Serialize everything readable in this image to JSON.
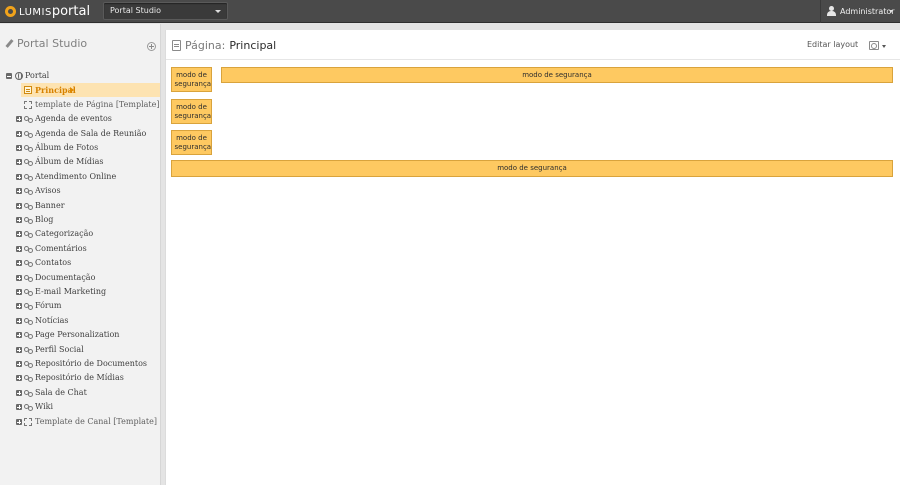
{
  "topbar": {
    "logo_prefix": "LUMIS",
    "logo_suffix": "portal",
    "portal_select_value": "Portal Studio",
    "user_name": "Administrator",
    "colors": {
      "bar": "#4a4a4a",
      "logo_accent": "#f1a31b"
    }
  },
  "sidebar": {
    "title": "Portal Studio",
    "tree": [
      {
        "label": "Portal",
        "icon": "globe-icon",
        "toggle": "collapse"
      },
      {
        "label": "Principal",
        "icon": "page-icon",
        "selected": true
      },
      {
        "label": "template de Página [Template]",
        "icon": "template-icon"
      },
      {
        "label": "Agenda de eventos",
        "icon": "channel-icon",
        "toggle": "expand"
      },
      {
        "label": "Agenda de Sala de Reunião",
        "icon": "channel-icon",
        "toggle": "expand"
      },
      {
        "label": "Álbum de Fotos",
        "icon": "channel-icon",
        "toggle": "expand"
      },
      {
        "label": "Álbum de Mídias",
        "icon": "channel-icon",
        "toggle": "expand"
      },
      {
        "label": "Atendimento Online",
        "icon": "channel-icon",
        "toggle": "expand"
      },
      {
        "label": "Avisos",
        "icon": "channel-icon",
        "toggle": "expand"
      },
      {
        "label": "Banner",
        "icon": "channel-icon",
        "toggle": "expand"
      },
      {
        "label": "Blog",
        "icon": "channel-icon",
        "toggle": "expand"
      },
      {
        "label": "Categorização",
        "icon": "channel-icon",
        "toggle": "expand"
      },
      {
        "label": "Comentários",
        "icon": "channel-icon",
        "toggle": "expand"
      },
      {
        "label": "Contatos",
        "icon": "channel-icon",
        "toggle": "expand"
      },
      {
        "label": "Documentação",
        "icon": "channel-icon",
        "toggle": "expand"
      },
      {
        "label": "E-mail Marketing",
        "icon": "channel-icon",
        "toggle": "expand"
      },
      {
        "label": "Fórum",
        "icon": "channel-icon",
        "toggle": "expand"
      },
      {
        "label": "Notícias",
        "icon": "channel-icon",
        "toggle": "expand"
      },
      {
        "label": "Page Personalization",
        "icon": "channel-icon",
        "toggle": "expand"
      },
      {
        "label": "Perfil Social",
        "icon": "channel-icon",
        "toggle": "expand"
      },
      {
        "label": "Repositório de Documentos",
        "icon": "channel-icon",
        "toggle": "expand"
      },
      {
        "label": "Repositório de Mídias",
        "icon": "channel-icon",
        "toggle": "expand"
      },
      {
        "label": "Sala de Chat",
        "icon": "channel-icon",
        "toggle": "expand"
      },
      {
        "label": "Wiki",
        "icon": "channel-icon",
        "toggle": "expand"
      },
      {
        "label": "Template de Canal [Template]",
        "icon": "template-icon",
        "toggle": "expand"
      }
    ]
  },
  "main": {
    "page_label": "Página:",
    "page_name": "Principal",
    "edit_layout": "Editar layout",
    "safe_mode": "modo de segurança",
    "safe_mode_small": "modo de\nsegurança",
    "colors": {
      "safe_fill": "#fec961",
      "safe_border": "#d9a33c",
      "selected_text": "#d78200",
      "selected_bg": "#fde3b1"
    }
  }
}
